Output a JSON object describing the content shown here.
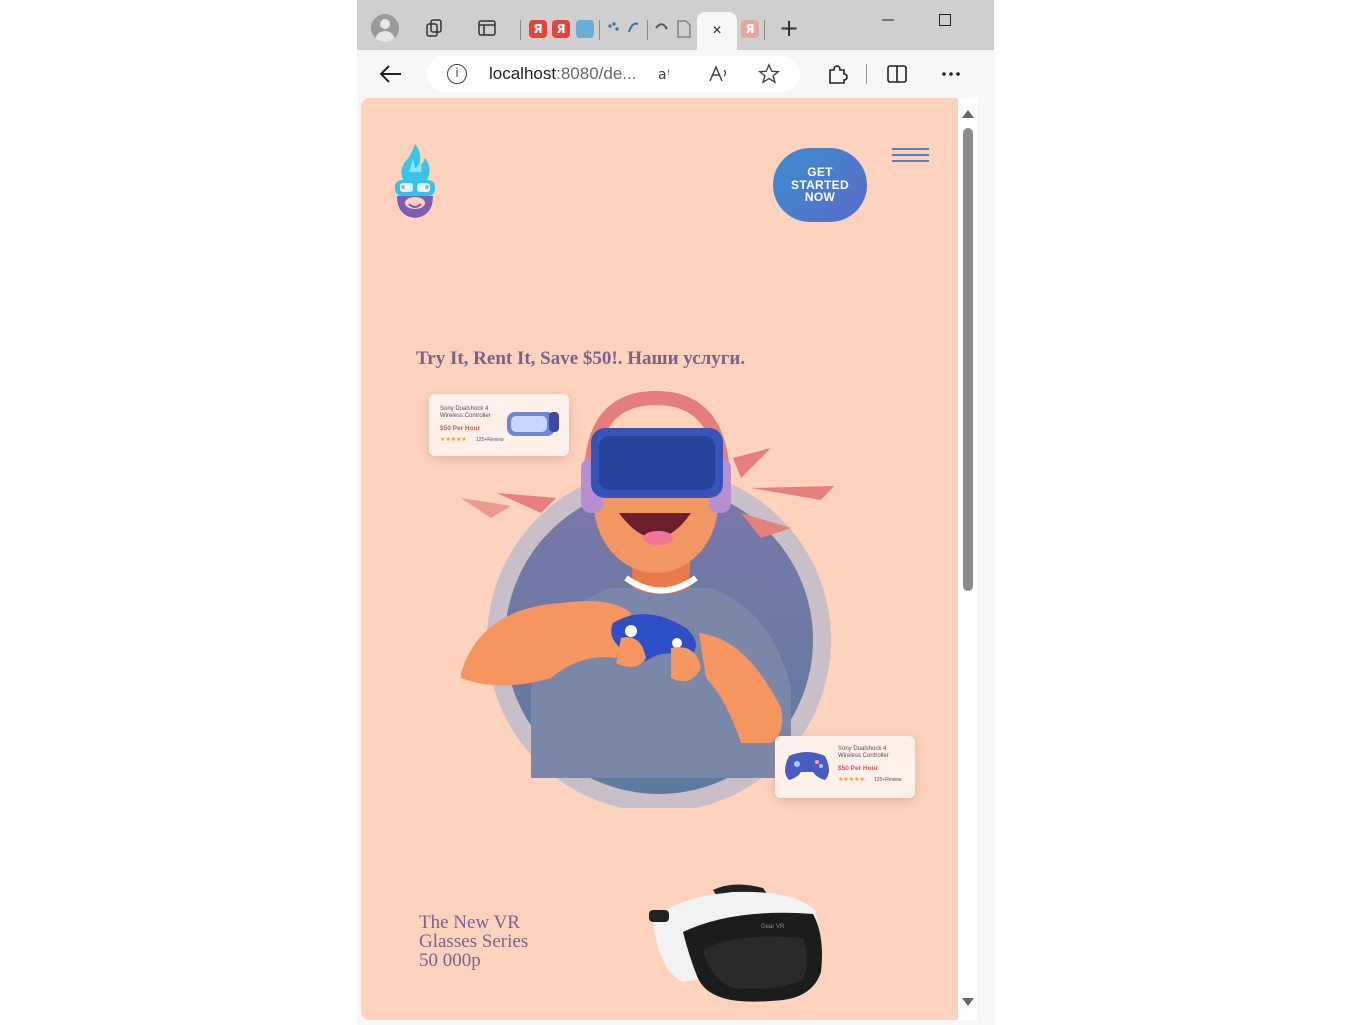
{
  "browser": {
    "tabs": [
      {
        "name": "yandex-1",
        "letter": "Я",
        "color": "#e8433a"
      },
      {
        "name": "yandex-2",
        "letter": "Я",
        "color": "#e8433a"
      },
      {
        "name": "tab-3",
        "letter": "",
        "color": "#6aaed8"
      },
      {
        "name": "tab-4",
        "letter": "",
        "color": "#2f6fb7"
      },
      {
        "name": "tab-5",
        "letter": "",
        "color": "#555555"
      },
      {
        "name": "tab-6",
        "letter": "",
        "color": "#bbbbbb"
      },
      {
        "name": "yandex-7",
        "letter": "Я",
        "color": "#e8a59b"
      }
    ],
    "active_tab_close": "×",
    "new_tab": "+",
    "url_host": "localhost",
    "url_rest": ":8080/de..."
  },
  "page": {
    "cta_label": "GET STARTED NOW",
    "tagline": "Try It, Rent It, Save $50!. Наши услуги.",
    "card_top": {
      "name": "Sony Dualshock 4 Wireless Controller",
      "price": "$50 Per Hour",
      "stars": "★★★★★",
      "reviews": "125+Review"
    },
    "card_bottom": {
      "name": "Sony Dualshock 4 Wireless Controller",
      "price": "$50 Per Hour",
      "stars": "★★★★★",
      "reviews": "125+Review"
    },
    "series_text": "The New VR\nGlasses Series\n50 000р",
    "vr_brand_print": "Gear VR"
  },
  "colors": {
    "page_bg": "#fdd3bd",
    "accent_text": "#7a6190",
    "cta_gradient_start": "#3a8dd0",
    "cta_gradient_end": "#5a6cc8"
  }
}
